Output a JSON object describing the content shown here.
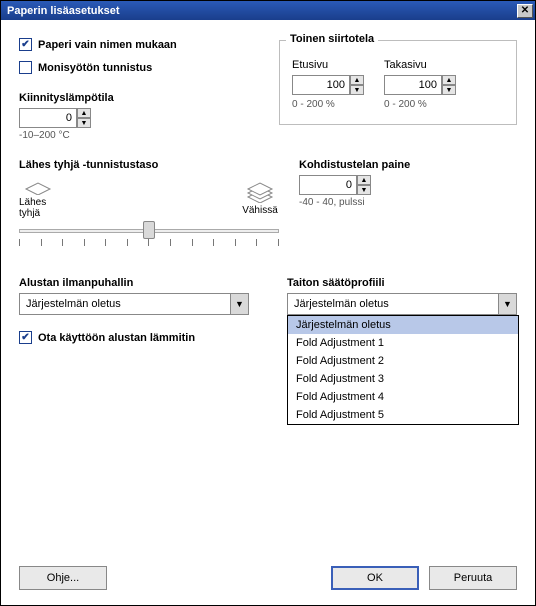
{
  "title": "Paperin lisäasetukset",
  "checkboxes": {
    "paper_by_name": "Paperi vain nimen mukaan",
    "multifeed": "Monisyötön tunnistus",
    "tray_heater": "Ota käyttöön alustan lämmitin"
  },
  "transfer_roll": {
    "legend": "Toinen siirtotela",
    "front_label": "Etusivu",
    "back_label": "Takasivu",
    "front_value": "100",
    "back_value": "100",
    "range": "0 - 200 %"
  },
  "fuser": {
    "label": "Kiinnityslämpötila",
    "value": "0",
    "range": "-10–200 °C"
  },
  "threshold": {
    "label": "Lähes tyhjä -tunnistustaso",
    "left": "Lähes tyhjä",
    "right": "Vähissä"
  },
  "aligner": {
    "label": "Kohdistustelan paine",
    "value": "0",
    "range": "-40 - 40, pulssi"
  },
  "blower": {
    "label": "Alustan ilmanpuhallin",
    "selected": "Järjestelmän oletus"
  },
  "fold": {
    "label": "Taiton säätöprofiili",
    "selected": "Järjestelmän oletus",
    "options": [
      "Järjestelmän oletus",
      "Fold Adjustment 1",
      "Fold Adjustment 2",
      "Fold Adjustment 3",
      "Fold Adjustment 4",
      "Fold Adjustment 5"
    ]
  },
  "buttons": {
    "help": "Ohje...",
    "ok": "OK",
    "cancel": "Peruuta"
  }
}
